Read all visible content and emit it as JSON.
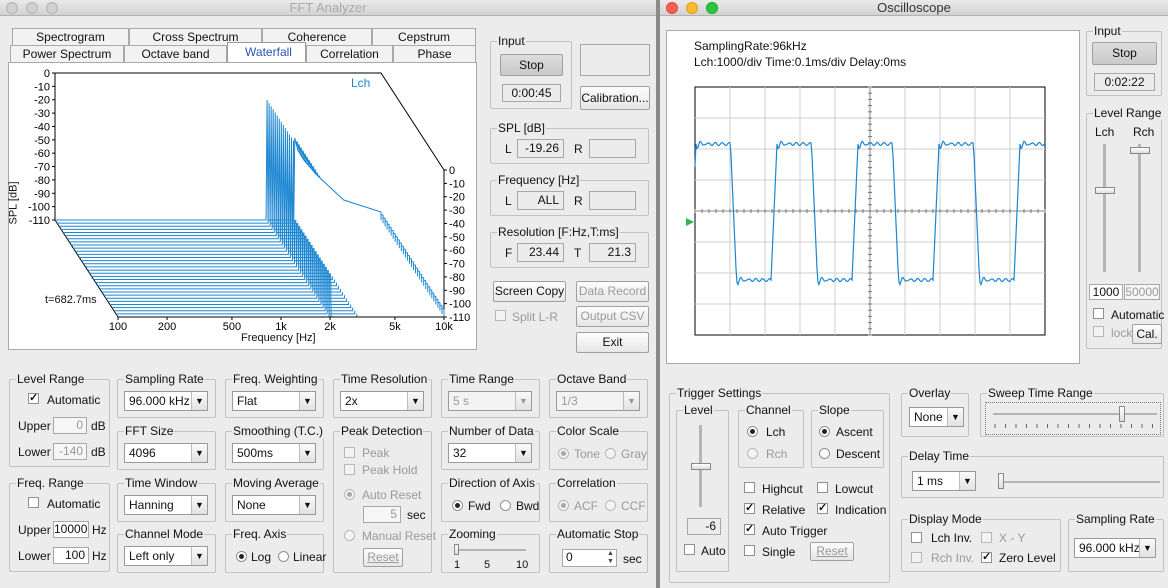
{
  "fft": {
    "title": "FFT Analyzer",
    "tabs_row1": [
      "Spectrogram",
      "Cross Spectrum",
      "Coherence",
      "Cepstrum"
    ],
    "tabs_row2": [
      "Power Spectrum",
      "Octave band",
      "Waterfall",
      "Correlation",
      "Phase"
    ],
    "plot": {
      "channel": "Lch",
      "ylabel": "SPL [dB]",
      "xlabel": "Frequency [Hz]",
      "y_ticks": [
        "0",
        "-10",
        "-20",
        "-30",
        "-40",
        "-50",
        "-60",
        "-70",
        "-80",
        "-90",
        "-100",
        "-110"
      ],
      "x_ticks": [
        "100",
        "200",
        "500",
        "1k",
        "2k",
        "5k",
        "10k"
      ],
      "time": "t=682.7ms",
      "accent": "#1c86d1"
    },
    "input": {
      "caption": "Input",
      "stop": "Stop",
      "time": "0:00:45"
    },
    "calibration": "Calibration...",
    "spl": {
      "caption": "SPL [dB]",
      "l": "L",
      "l_val": "-19.26",
      "r": "R",
      "r_val": ""
    },
    "frequency": {
      "caption": "Frequency [Hz]",
      "l": "L",
      "l_val": "ALL",
      "r": "R",
      "r_val": ""
    },
    "resolution": {
      "caption": "Resolution [F:Hz,T:ms]",
      "f": "F",
      "f_val": "23.44",
      "t": "T",
      "t_val": "21.3"
    },
    "screen_copy": "Screen Copy",
    "data_record": "Data Record",
    "split_lr": "Split L-R",
    "output_csv": "Output CSV",
    "exit": "Exit",
    "level_range": {
      "caption": "Level Range",
      "automatic": "Automatic",
      "upper": "Upper",
      "upper_val": "0",
      "lower": "Lower",
      "lower_val": "-140",
      "unit": "dB"
    },
    "freq_range": {
      "caption": "Freq. Range",
      "automatic": "Automatic",
      "upper": "Upper",
      "upper_val": "10000",
      "lower": "Lower",
      "lower_val": "100",
      "unit": "Hz"
    },
    "sampling_rate": {
      "caption": "Sampling Rate",
      "value": "96.000 kHz"
    },
    "fft_size": {
      "caption": "FFT Size",
      "value": "4096"
    },
    "time_window": {
      "caption": "Time Window",
      "value": "Hanning"
    },
    "channel_mode": {
      "caption": "Channel Mode",
      "value": "Left only"
    },
    "freq_weighting": {
      "caption": "Freq. Weighting",
      "value": "Flat"
    },
    "smoothing": {
      "caption": "Smoothing (T.C.)",
      "value": "500ms"
    },
    "moving_average": {
      "caption": "Moving Average",
      "value": "None"
    },
    "freq_axis": {
      "caption": "Freq. Axis",
      "log": "Log",
      "linear": "Linear"
    },
    "time_resolution": {
      "caption": "Time Resolution",
      "value": "2x"
    },
    "peak_detection": {
      "caption": "Peak Detection",
      "peak": "Peak",
      "peak_hold": "Peak Hold",
      "auto_reset": "Auto Reset",
      "sec_val": "5",
      "sec": "sec",
      "manual_reset": "Manual Reset",
      "reset": "Reset"
    },
    "time_range": {
      "caption": "Time Range",
      "value": "5 s"
    },
    "number_of_data": {
      "caption": "Number of Data",
      "value": "32"
    },
    "direction": {
      "caption": "Direction of Axis",
      "fwd": "Fwd",
      "bwd": "Bwd"
    },
    "zooming": {
      "caption": "Zooming",
      "ticks": [
        "1",
        "5",
        "10"
      ]
    },
    "octave_band": {
      "caption": "Octave Band",
      "value": "1/3"
    },
    "color_scale": {
      "caption": "Color Scale",
      "tone": "Tone",
      "gray": "Gray"
    },
    "correlation": {
      "caption": "Correlation",
      "acf": "ACF",
      "ccf": "CCF"
    },
    "auto_stop": {
      "caption": "Automatic Stop",
      "value": "0",
      "unit": "sec"
    }
  },
  "osc": {
    "title": "Oscilloscope",
    "header1": "SamplingRate:96kHz",
    "header2": "Lch:1000/div  Time:0.1ms/div  Delay:0ms",
    "trace_color": "#1c86d1",
    "input": {
      "caption": "Input",
      "stop": "Stop",
      "time": "0:02:22"
    },
    "level_range": {
      "caption": "Level Range",
      "lch": "Lch",
      "rch": "Rch",
      "val1": "1000",
      "val2": "50000",
      "automatic": "Automatic",
      "lock": "lock",
      "cal": "Cal."
    },
    "trigger": {
      "caption": "Trigger Settings",
      "level": "Level",
      "level_val": "-6",
      "auto": "Auto",
      "channel": "Channel",
      "lch": "Lch",
      "rch": "Rch",
      "slope": "Slope",
      "ascent": "Ascent",
      "descent": "Descent",
      "highcut": "Highcut",
      "lowcut": "Lowcut",
      "relative": "Relative",
      "indication": "Indication",
      "auto_trigger": "Auto Trigger",
      "single": "Single",
      "reset": "Reset"
    },
    "overlay": {
      "caption": "Overlay",
      "value": "None"
    },
    "sweep": {
      "caption": "Sweep Time Range"
    },
    "delay": {
      "caption": "Delay Time",
      "value": "1 ms"
    },
    "display_mode": {
      "caption": "Display Mode",
      "lch_inv": "Lch Inv.",
      "xy": "X - Y",
      "rch_inv": "Rch Inv.",
      "zero_level": "Zero Level"
    },
    "sampling_rate": {
      "caption": "Sampling Rate",
      "value": "96.000 kHz"
    }
  }
}
